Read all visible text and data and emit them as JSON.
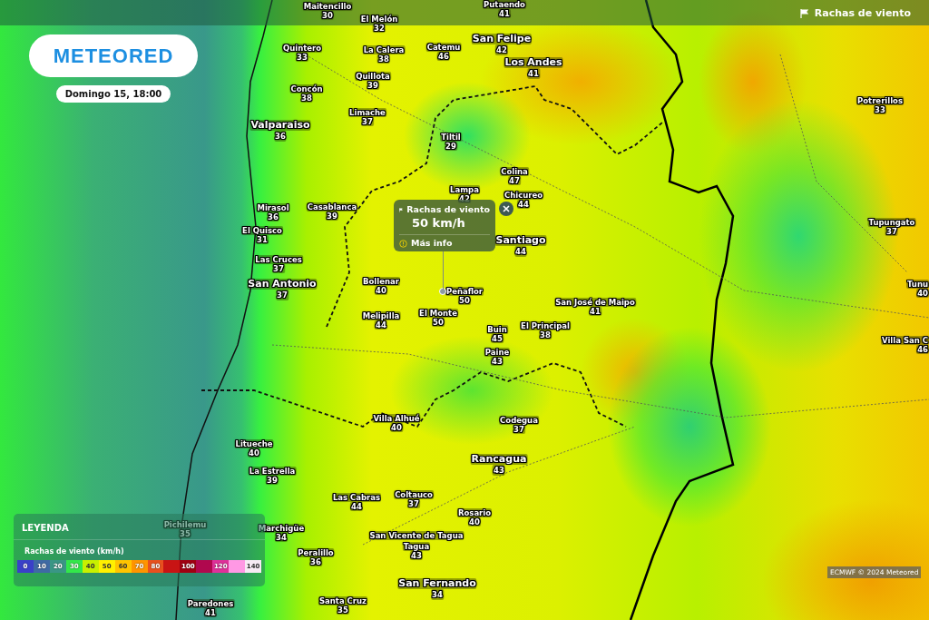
{
  "header": {
    "layer": "Rachas de viento"
  },
  "logo": {
    "text": "METEORED"
  },
  "date": "Domingo 15, 18:00",
  "popup": {
    "title": "Rachas de viento",
    "value": "50 km/h",
    "link": "Más info"
  },
  "cities": [
    {
      "name": "Maitencillo",
      "value": "30",
      "selected": false
    },
    {
      "name": "El Melón",
      "value": "32",
      "selected": false
    },
    {
      "name": "Putaendo",
      "value": "41",
      "selected": false
    },
    {
      "name": "Quintero",
      "value": "33",
      "selected": false
    },
    {
      "name": "La Calera",
      "value": "38",
      "selected": false
    },
    {
      "name": "Catemu",
      "value": "46",
      "selected": false
    },
    {
      "name": "San Felipe",
      "value": "42",
      "selected": false
    },
    {
      "name": "Los Andes",
      "value": "41",
      "selected": false
    },
    {
      "name": "Quillota",
      "value": "39",
      "selected": false
    },
    {
      "name": "Concón",
      "value": "38",
      "selected": false
    },
    {
      "name": "Limache",
      "value": "37",
      "selected": false
    },
    {
      "name": "Valparaiso",
      "value": "36",
      "selected": false
    },
    {
      "name": "Tiltil",
      "value": "29",
      "selected": false
    },
    {
      "name": "Colina",
      "value": "47",
      "selected": false
    },
    {
      "name": "Lampa",
      "value": "42",
      "selected": false
    },
    {
      "name": "Chicureo",
      "value": "44",
      "selected": false
    },
    {
      "name": "Mirasol",
      "value": "36",
      "selected": false
    },
    {
      "name": "Casablanca",
      "value": "39",
      "selected": false
    },
    {
      "name": "El Quisco",
      "value": "31",
      "selected": false
    },
    {
      "name": "Santiago",
      "value": "44",
      "selected": false
    },
    {
      "name": "Las Cruces",
      "value": "37",
      "selected": false
    },
    {
      "name": "San Antonio",
      "value": "37",
      "selected": false
    },
    {
      "name": "Bollenar",
      "value": "40",
      "selected": false
    },
    {
      "name": "Peñaflor",
      "value": "50",
      "selected": true
    },
    {
      "name": "San José de Maipo",
      "value": "41",
      "selected": false
    },
    {
      "name": "Melipilla",
      "value": "44",
      "selected": false
    },
    {
      "name": "El Monte",
      "value": "50",
      "selected": false
    },
    {
      "name": "Buin",
      "value": "45",
      "selected": false
    },
    {
      "name": "El Principal",
      "value": "38",
      "selected": false
    },
    {
      "name": "Paine",
      "value": "43",
      "selected": false
    },
    {
      "name": "Potrerillos",
      "value": "33",
      "selected": false
    },
    {
      "name": "Tupungato",
      "value": "37",
      "selected": false
    },
    {
      "name": "Tunu",
      "value": "40",
      "selected": false
    },
    {
      "name": "Villa San C",
      "value": "46",
      "selected": false
    },
    {
      "name": "Villa Alhué",
      "value": "40",
      "selected": false
    },
    {
      "name": "Codegua",
      "value": "37",
      "selected": false
    },
    {
      "name": "Litueche",
      "value": "40",
      "selected": false
    },
    {
      "name": "Rancagua",
      "value": "43",
      "selected": false
    },
    {
      "name": "La Estrella",
      "value": "39",
      "selected": false
    },
    {
      "name": "Las Cabras",
      "value": "44",
      "selected": false
    },
    {
      "name": "Coltauco",
      "value": "37",
      "selected": false
    },
    {
      "name": "Rosario",
      "value": "40",
      "selected": false
    },
    {
      "name": "Pichilemu",
      "value": "35",
      "selected": false
    },
    {
      "name": "Marchigüe",
      "value": "34",
      "selected": false
    },
    {
      "name": "San Vicente de Tagua",
      "selected": false
    },
    {
      "name": "Tagua",
      "value": "43",
      "selected": false
    },
    {
      "name": "Peralillo",
      "value": "36",
      "selected": false
    },
    {
      "name": "San Fernando",
      "value": "34",
      "selected": false
    },
    {
      "name": "Paredones",
      "value": "41",
      "selected": false
    },
    {
      "name": "Santa Cruz",
      "value": "35",
      "selected": false
    }
  ],
  "legend": {
    "title": "LEYENDA",
    "subtitle": "Rachas de viento (km/h)",
    "scale": [
      {
        "label": "0",
        "color": "#3a40c8"
      },
      {
        "label": "10",
        "color": "#3f6aa4"
      },
      {
        "label": "20",
        "color": "#3a9685"
      },
      {
        "label": "30",
        "color": "#33e84a"
      },
      {
        "label": "40",
        "color": "#c8f000"
      },
      {
        "label": "50",
        "color": "#fff000"
      },
      {
        "label": "60",
        "color": "#ffc400"
      },
      {
        "label": "70",
        "color": "#ff9400"
      },
      {
        "label": "80",
        "color": "#e8501e"
      },
      {
        "color": "#c81414"
      },
      {
        "label": "100",
        "color": "#a00012"
      },
      {
        "color": "#b0084e"
      },
      {
        "label": "120",
        "color": "#e0309a"
      },
      {
        "color": "#ff98e4"
      },
      {
        "label": "140",
        "color": "#f6eaf4"
      }
    ]
  },
  "attribution": "ECMWF © 2024 Meteored"
}
